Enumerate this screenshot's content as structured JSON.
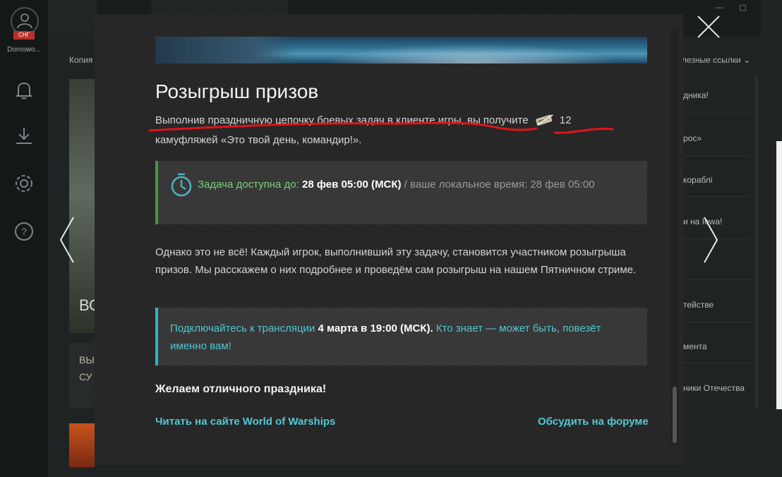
{
  "sidebar": {
    "region": "СНГ",
    "user_name": "Domowo..."
  },
  "background": {
    "crumb_left": "Копия",
    "crumb_right": "лезные ссылки ⌄",
    "card_text": "ВО",
    "card2_text_line1": "ВЫ",
    "card2_text_line2": "СУ",
    "window_controls": "— ▢ ✕",
    "right_links": [
      "дника!",
      "рос»",
      "кораблі",
      "и на Iowa!",
      "тействе",
      "мента",
      "ники Отечества"
    ]
  },
  "modal": {
    "title": "Розыгрыш призов",
    "intro_before_icon": "Выполнив праздничную цепочку боевых задач в клиенте игры, вы получите",
    "reward_count": "12",
    "intro_after": "камуфляжей «Это твой день, командир!».",
    "task_label": "Задача доступна до:",
    "task_date": "28 фев 05:00 (МСК)",
    "task_local": " / ваше локальное время: 28 фев 05:00",
    "body_text": "Однако это не всё! Каждый игрок, выполнивший эту задачу, становится участником розыгрыша призов. Мы расскажем о них подробнее и проведём сам розыгрыш на нашем Пятничном стриме.",
    "stream_part1": "Подключайтесь к трансляции",
    "stream_date": "4 марта в 19:00 (МСК).",
    "stream_part2": "Кто знает — может быть, повезёт именно вам!",
    "wish": "Желаем отличного праздника!",
    "link_site": "Читать на сайте World of Warships",
    "link_forum": "Обсудить на форуме"
  },
  "colors": {
    "accent_cyan": "#52c6d4",
    "task_green": "#3e9a3e",
    "annotation_red": "#e0141b"
  },
  "icons": [
    "user-icon",
    "bell-icon",
    "download-icon",
    "gear-icon",
    "help-icon",
    "close-icon",
    "arrow-left-icon",
    "arrow-right-icon",
    "timer-icon",
    "camouflage-icon"
  ]
}
